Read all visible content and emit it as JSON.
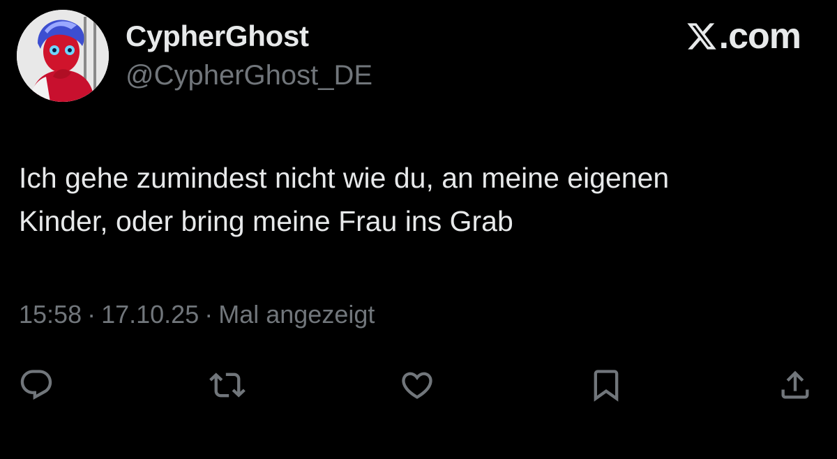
{
  "author": {
    "display_name": "CypherGhost",
    "handle": "@CypherGhost_DE",
    "avatar_icon": "profile-avatar"
  },
  "brand": {
    "label": ".com",
    "icon": "x-logo-icon"
  },
  "tweet": {
    "text": "Ich gehe zumindest nicht wie du, an meine eigenen\nKinder, oder bring meine Frau ins Grab"
  },
  "meta": {
    "time": "15:58",
    "date": "17.10.25",
    "views": "Mal angezeigt",
    "separator": "·"
  },
  "actions": {
    "icons": [
      "reply-icon",
      "repost-icon",
      "like-icon",
      "bookmark-icon",
      "share-icon"
    ]
  },
  "colors": {
    "background": "#000000",
    "text_primary": "#e7e9ea",
    "text_secondary": "#71767b"
  }
}
